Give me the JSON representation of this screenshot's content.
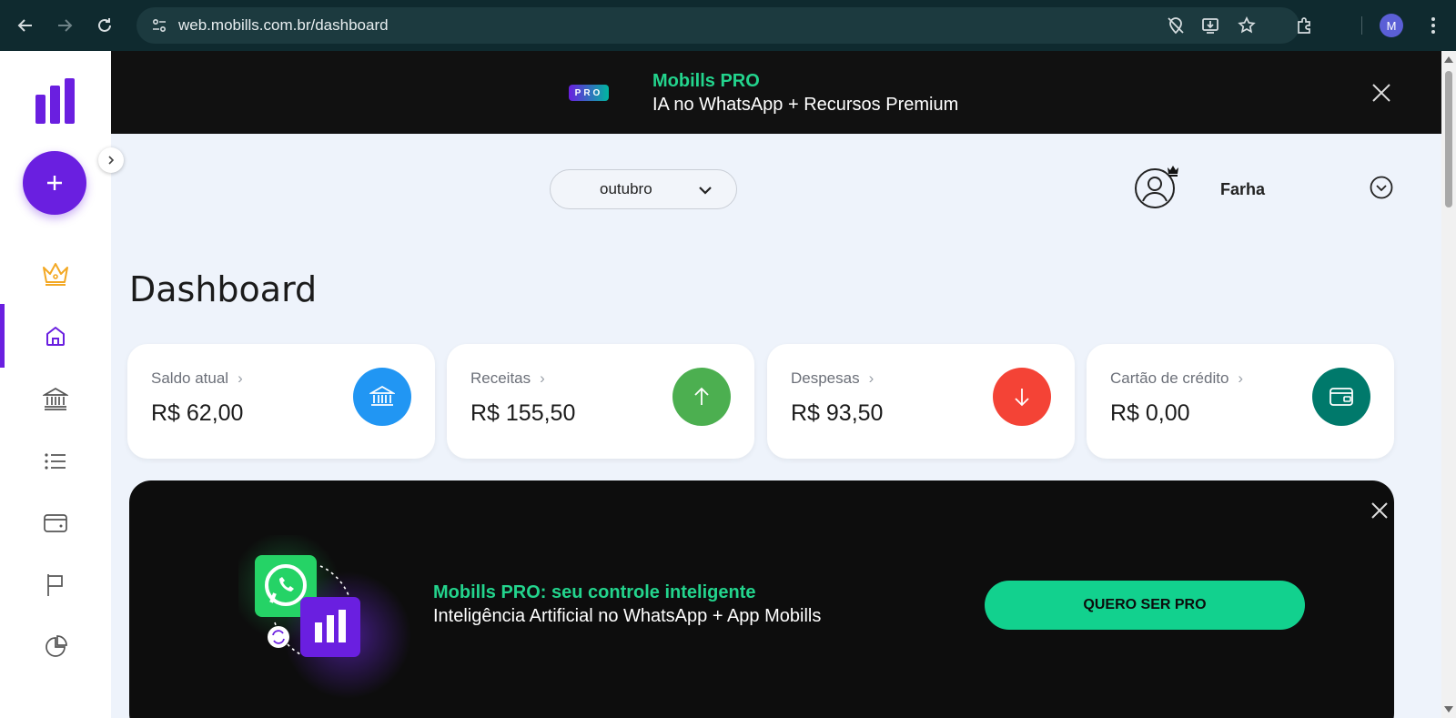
{
  "browser": {
    "url": "web.mobills.com.br/dashboard",
    "profile_initial": "M"
  },
  "promo_top": {
    "badge": "PRO",
    "title": "Mobills PRO",
    "subtitle": "IA no WhatsApp + Recursos Premium"
  },
  "header": {
    "month": "outubro",
    "user_name": "Farha"
  },
  "page": {
    "title": "Dashboard"
  },
  "cards": [
    {
      "label": "Saldo atual",
      "amount": "R$ 62,00",
      "color": "#2196f3",
      "icon": "bank-icon"
    },
    {
      "label": "Receitas",
      "amount": "R$ 155,50",
      "color": "#4caf50",
      "icon": "arrow-up-icon"
    },
    {
      "label": "Despesas",
      "amount": "R$ 93,50",
      "color": "#f44336",
      "icon": "arrow-down-icon"
    },
    {
      "label": "Cartão de crédito",
      "amount": "R$ 0,00",
      "color": "#00796b",
      "icon": "wallet-icon"
    }
  ],
  "banner": {
    "title": "Mobills PRO: seu controle inteligente",
    "subtitle": "Inteligência Artificial no WhatsApp + App Mobills",
    "cta": "QUERO SER PRO"
  },
  "sidebar": {
    "items": [
      "crown-icon",
      "home-icon",
      "bank-icon",
      "list-icon",
      "card-icon",
      "flag-icon",
      "pie-chart-icon"
    ]
  },
  "colors": {
    "brand": "#6a1fe0",
    "pro_green": "#23d48d",
    "cta_green": "#12d18e"
  }
}
